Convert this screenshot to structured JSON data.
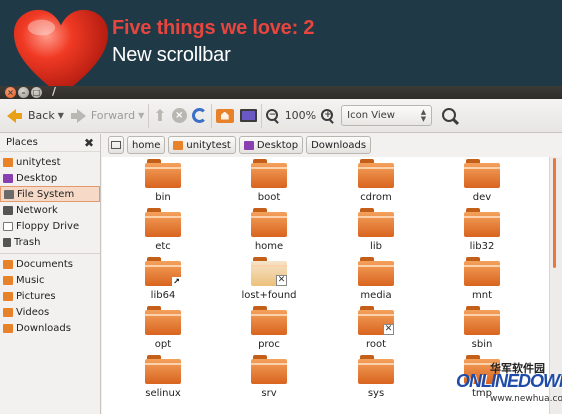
{
  "banner": {
    "title": "Five things we love: 2",
    "subtitle": "New scrollbar"
  },
  "window": {
    "title": "/",
    "buttons": [
      "close-icon",
      "minimize-icon",
      "maximize-icon"
    ]
  },
  "toolbar": {
    "back_label": "Back",
    "forward_label": "Forward",
    "zoom_level": "100%",
    "view_mode": "Icon View"
  },
  "sidebar": {
    "heading": "Places",
    "items": [
      {
        "label": "unitytest",
        "icon": "home-folder-icon",
        "color": "#e8822a"
      },
      {
        "label": "Desktop",
        "icon": "desktop-icon",
        "color": "#8a3fb0"
      },
      {
        "label": "File System",
        "icon": "filesystem-icon",
        "color": "#6b6b6b",
        "selected": true
      },
      {
        "label": "Network",
        "icon": "network-icon",
        "color": "#555555"
      },
      {
        "label": "Floppy Drive",
        "icon": "floppy-icon",
        "color": "#777777"
      },
      {
        "label": "Trash",
        "icon": "trash-icon",
        "color": "#555555"
      },
      {
        "label": "Documents",
        "icon": "documents-folder-icon",
        "color": "#e8822a"
      },
      {
        "label": "Music",
        "icon": "music-folder-icon",
        "color": "#e8822a"
      },
      {
        "label": "Pictures",
        "icon": "pictures-folder-icon",
        "color": "#e8822a"
      },
      {
        "label": "Videos",
        "icon": "videos-folder-icon",
        "color": "#e8822a"
      },
      {
        "label": "Downloads",
        "icon": "downloads-folder-icon",
        "color": "#e8822a"
      }
    ]
  },
  "pathbar": {
    "crumbs": [
      "home",
      "unitytest",
      "Desktop",
      "Downloads"
    ]
  },
  "files": [
    {
      "name": "bin"
    },
    {
      "name": "boot"
    },
    {
      "name": "cdrom"
    },
    {
      "name": "dev"
    },
    {
      "name": "etc"
    },
    {
      "name": "home"
    },
    {
      "name": "lib"
    },
    {
      "name": "lib32"
    },
    {
      "name": "lib64",
      "badge": "link"
    },
    {
      "name": "lost+found",
      "badge": "locked",
      "style": "doc"
    },
    {
      "name": "media"
    },
    {
      "name": "mnt"
    },
    {
      "name": "opt"
    },
    {
      "name": "proc"
    },
    {
      "name": "root",
      "badge": "locked"
    },
    {
      "name": "sbin"
    },
    {
      "name": "selinux"
    },
    {
      "name": "srv"
    },
    {
      "name": "sys"
    },
    {
      "name": "tmp"
    }
  ],
  "scrollbar": {
    "accent": "#e57a3c"
  },
  "watermark": {
    "cn": "华军软件园",
    "brand": "ONLINEDOWN",
    "url": "www.newhua.com"
  }
}
